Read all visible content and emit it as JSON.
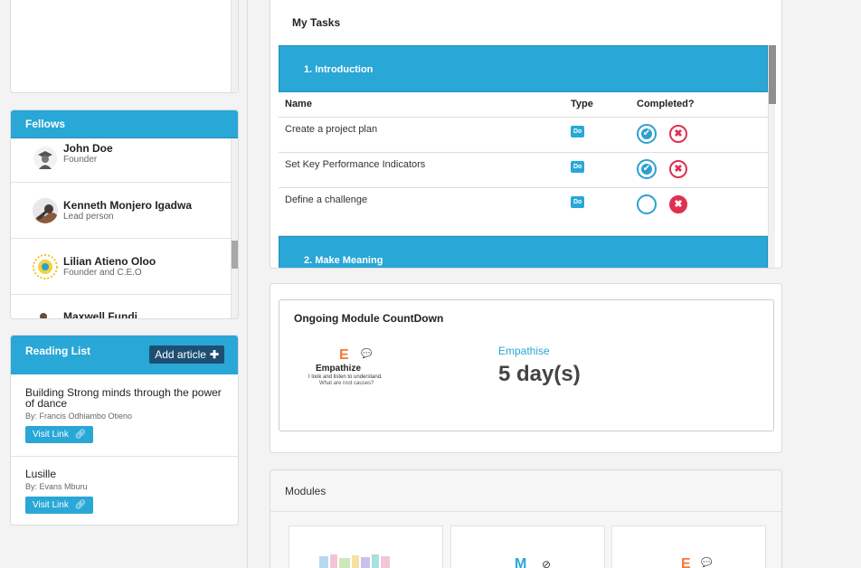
{
  "tasks": {
    "title": "My Tasks",
    "sections": [
      {
        "label": "1. Introduction",
        "columns": [
          "Name",
          "Type",
          "Completed?"
        ],
        "rows": [
          {
            "name": "Create a project plan",
            "type": "Do",
            "completed": true
          },
          {
            "name": "Set Key Performance Indicators",
            "type": "Do",
            "completed": true
          },
          {
            "name": "Define a challenge",
            "type": "Do",
            "completed": false
          }
        ]
      },
      {
        "label": "2. Make Meaning"
      }
    ]
  },
  "fellows": {
    "title": "Fellows",
    "items": [
      {
        "name": "John Doe",
        "role": "Founder"
      },
      {
        "name": "Kenneth Monjero Igadwa",
        "role": "Lead person"
      },
      {
        "name": "Lilian Atieno Oloo",
        "role": "Founder and C.E.O"
      },
      {
        "name": "Maxwell Fundi",
        "role": ""
      }
    ]
  },
  "reading": {
    "title": "Reading List",
    "add_label": "Add article",
    "visit_label": "Visit Link",
    "items": [
      {
        "title": "Building Strong minds through the power of dance",
        "by": "By: Francis Odhiambo Otieno"
      },
      {
        "title": "Lusille",
        "by": "By: Evans Mburu"
      }
    ]
  },
  "countdown": {
    "title": "Ongoing Module CountDown",
    "logo_letter": "E",
    "logo_word": "Empathize",
    "logo_line1": "I look and listen to understand.",
    "logo_line2": "What are root causes?",
    "module": "Empathise",
    "days": "5 day(s)"
  },
  "modules": {
    "title": "Modules",
    "tile2_letter": "M",
    "tile3_letter": "E"
  },
  "colors": {
    "accent": "#29a7d6",
    "danger": "#e03050",
    "dark_button": "#1d4f73",
    "logo_orange": "#f07b3a"
  }
}
